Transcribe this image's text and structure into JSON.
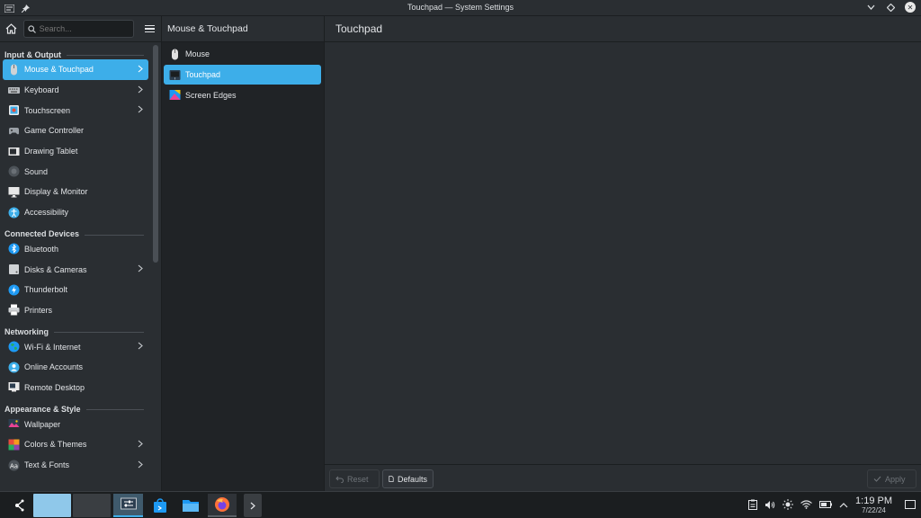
{
  "window": {
    "title": "Touchpad — System Settings"
  },
  "sidebar": {
    "search_placeholder": "Search...",
    "categories": [
      {
        "label": "Input & Output",
        "items": [
          {
            "label": "Mouse & Touchpad",
            "chevron": true,
            "active": true,
            "icon": "mouse-icon",
            "color": "#cfd3d6"
          },
          {
            "label": "Keyboard",
            "chevron": true,
            "icon": "keyboard-icon",
            "color": "#b8bcc0"
          },
          {
            "label": "Touchscreen",
            "chevron": true,
            "icon": "touchscreen-icon",
            "color": "#3daee9"
          },
          {
            "label": "Game Controller",
            "icon": "gamepad-icon",
            "color": "#9aa0a6"
          },
          {
            "label": "Drawing Tablet",
            "icon": "tablet-icon",
            "color": "#e8e8e8"
          },
          {
            "label": "Sound",
            "icon": "speaker-icon",
            "color": "#4d5359"
          },
          {
            "label": "Display & Monitor",
            "icon": "monitor-icon",
            "color": "#e8e8e8"
          },
          {
            "label": "Accessibility",
            "icon": "accessibility-icon",
            "color": "#3daee9"
          }
        ]
      },
      {
        "label": "Connected Devices",
        "items": [
          {
            "label": "Bluetooth",
            "icon": "bluetooth-icon",
            "color": "#1d99f3"
          },
          {
            "label": "Disks & Cameras",
            "chevron": true,
            "icon": "disk-icon",
            "color": "#d0d3d6"
          },
          {
            "label": "Thunderbolt",
            "icon": "thunderbolt-icon",
            "color": "#1d99f3"
          },
          {
            "label": "Printers",
            "icon": "printer-icon",
            "color": "#d0d3d6"
          }
        ]
      },
      {
        "label": "Networking",
        "items": [
          {
            "label": "Wi-Fi & Internet",
            "chevron": true,
            "icon": "globe-icon",
            "color": "#27ae60"
          },
          {
            "label": "Online Accounts",
            "icon": "accounts-icon",
            "color": "#3daee9"
          },
          {
            "label": "Remote Desktop",
            "icon": "remote-desktop-icon",
            "color": "#e8e8e8"
          }
        ]
      },
      {
        "label": "Appearance & Style",
        "items": [
          {
            "label": "Wallpaper",
            "icon": "wallpaper-icon",
            "color": "#8e44ad"
          },
          {
            "label": "Colors & Themes",
            "chevron": true,
            "icon": "palette-icon",
            "color": "#f39c1f"
          },
          {
            "label": "Text & Fonts",
            "chevron": true,
            "icon": "font-icon",
            "color": "#4d5359"
          }
        ]
      }
    ]
  },
  "subpanel": {
    "title": "Mouse & Touchpad",
    "items": [
      {
        "label": "Mouse",
        "icon": "mouse-icon",
        "color": "#e0e0e0"
      },
      {
        "label": "Touchpad",
        "icon": "touchpad-icon",
        "color": "#2c3e50",
        "active": true
      },
      {
        "label": "Screen Edges",
        "icon": "screen-edges-icon",
        "color": "#e84393"
      }
    ]
  },
  "main": {
    "title": "Touchpad",
    "reset_label": "Reset",
    "defaults_label": "Defaults",
    "apply_label": "Apply"
  },
  "taskbar": {
    "time": "1:19 PM",
    "date": "7/22/24"
  },
  "colors": {
    "accent": "#3daee9",
    "window_bg": "#2a2e32",
    "list_bg": "#202326"
  }
}
